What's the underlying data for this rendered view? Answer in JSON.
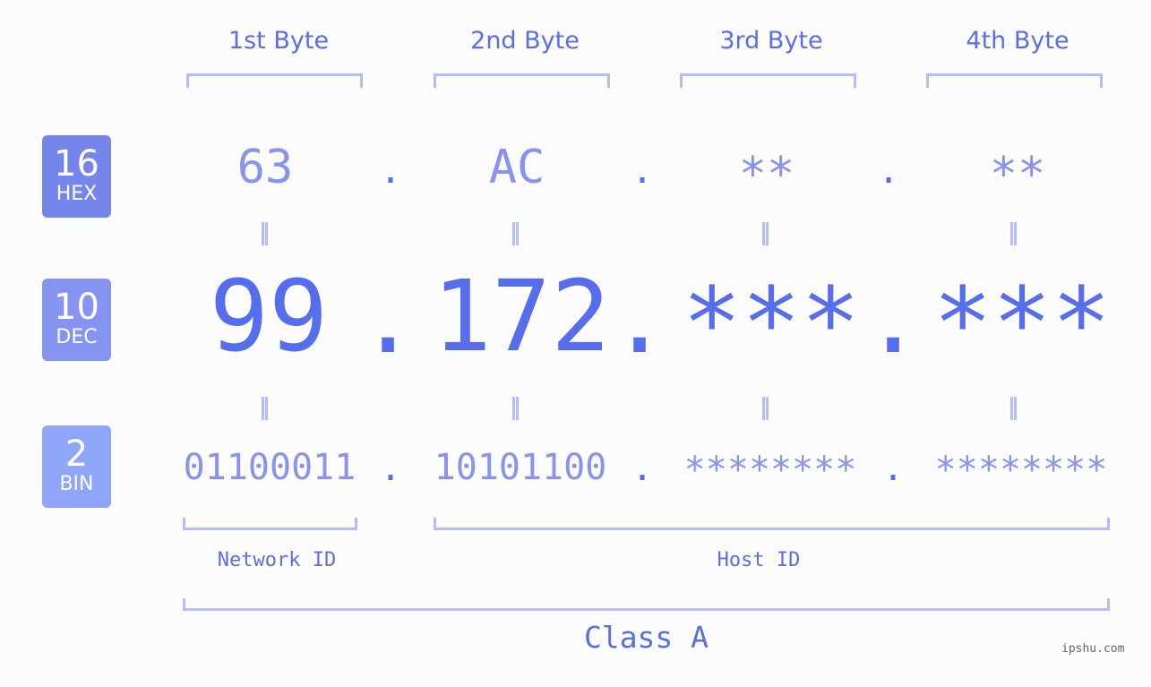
{
  "byte_headers": [
    "1st Byte",
    "2nd Byte",
    "3rd Byte",
    "4th Byte"
  ],
  "rows": {
    "hex": {
      "base": "16",
      "label": "HEX",
      "color": "#7585ec",
      "values": [
        "63",
        "AC",
        "**",
        "**"
      ]
    },
    "dec": {
      "base": "10",
      "label": "DEC",
      "color": "#8593f1",
      "values": [
        "99",
        "172",
        "***",
        "***"
      ]
    },
    "bin": {
      "base": "2",
      "label": "BIN",
      "color": "#8fa6f8",
      "values": [
        "01100011",
        "10101100",
        "********",
        "********"
      ]
    }
  },
  "separator": ".",
  "segments": {
    "network": "Network ID",
    "host": "Host ID"
  },
  "ip_class": "Class A",
  "watermark": "ipshu.com",
  "colors": {
    "accent": "#566ded",
    "light": "#8893ef",
    "bracket": "#b3bdf7"
  }
}
